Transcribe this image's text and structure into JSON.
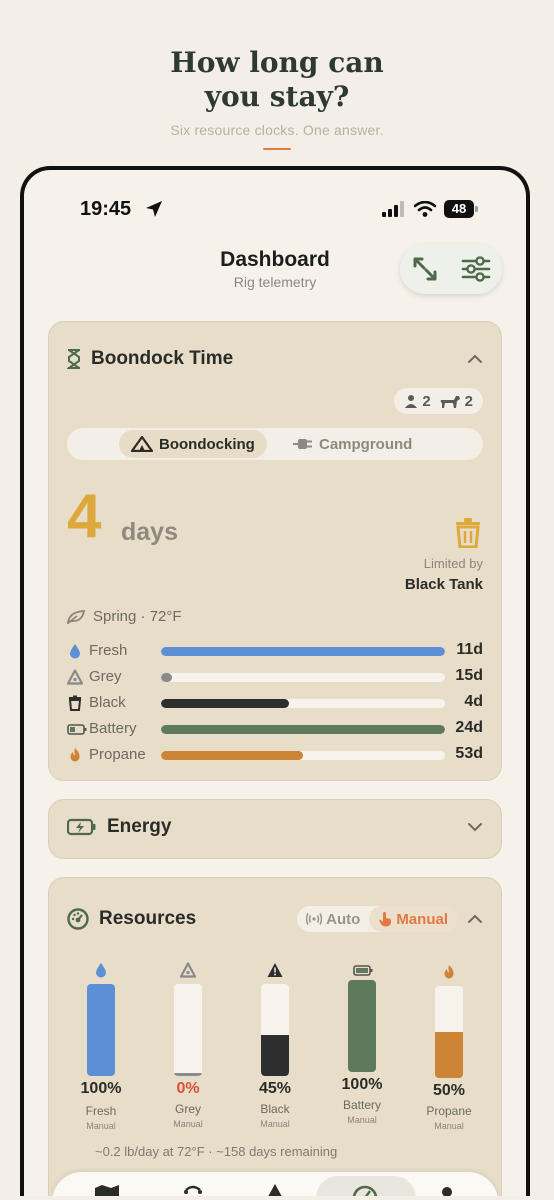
{
  "hero": {
    "title": "How long can you stay?",
    "subtitle": "Six resource clocks. One answer.",
    "accent_color": "#e07a43"
  },
  "status_bar": {
    "time": "19:45",
    "battery": "48",
    "icons": [
      "location-arrow-icon",
      "signal-icon",
      "wifi-icon",
      "battery-icon"
    ]
  },
  "header": {
    "title": "Dashboard",
    "subtitle": "Rig telemetry",
    "actions": [
      "expand-icon",
      "sliders-icon"
    ]
  },
  "boondock": {
    "title": "Boondock Time",
    "people": "2",
    "pets": "2",
    "modes": [
      "Boondocking",
      "Campground"
    ],
    "active_mode": "Boondocking",
    "days_value": "4",
    "days_unit": "days",
    "limited_by_label": "Limited by",
    "limited_by_value": "Black Tank",
    "season": "Spring · 72°F",
    "rows": [
      {
        "label": "Fresh",
        "value": "11d",
        "fraction": 1.0,
        "color": "#5b8fd6",
        "icon": "droplet-icon"
      },
      {
        "label": "Grey",
        "value": "15d",
        "fraction": 0.04,
        "color": "#8a8a8a",
        "icon": "warning-triangle-icon"
      },
      {
        "label": "Black",
        "value": "4d",
        "fraction": 0.45,
        "color": "#2e2e2e",
        "icon": "trash-icon"
      },
      {
        "label": "Battery",
        "value": "24d",
        "fraction": 1.0,
        "color": "#5e7a5c",
        "icon": "battery-icon"
      },
      {
        "label": "Propane",
        "value": "53d",
        "fraction": 0.5,
        "color": "#cd8435",
        "icon": "flame-icon"
      }
    ]
  },
  "energy": {
    "title": "Energy"
  },
  "resources": {
    "title": "Resources",
    "auto_label": "Auto",
    "manual_label": "Manual",
    "tanks": [
      {
        "name": "Fresh",
        "pct": "100%",
        "level": 1.0,
        "mode": "Manual",
        "color": "#5b8fd6",
        "pct_color": "#2a2c27",
        "icon": "droplet-icon"
      },
      {
        "name": "Grey",
        "pct": "0%",
        "level": 0.0,
        "mode": "Manual",
        "color": "#8a8a8a",
        "pct_color": "#d9533a",
        "icon": "warning-triangle-icon"
      },
      {
        "name": "Black",
        "pct": "45%",
        "level": 0.45,
        "mode": "Manual",
        "color": "#2e2e2e",
        "pct_color": "#2a2c27",
        "icon": "warning-triangle-icon"
      },
      {
        "name": "Battery",
        "pct": "100%",
        "level": 1.0,
        "mode": "Manual",
        "color": "#5e7a5c",
        "pct_color": "#2a2c27",
        "icon": "battery-icon"
      },
      {
        "name": "Propane",
        "pct": "50%",
        "level": 0.5,
        "mode": "Manual",
        "color": "#cd8435",
        "pct_color": "#2a2c27",
        "icon": "flame-icon"
      }
    ],
    "note": "~0.2 lb/day at 72°F · ~158 days remaining"
  },
  "tabbar": {
    "icons": [
      "map-icon",
      "route-icon",
      "tent-icon",
      "gauge-icon",
      "profile-icon"
    ]
  }
}
